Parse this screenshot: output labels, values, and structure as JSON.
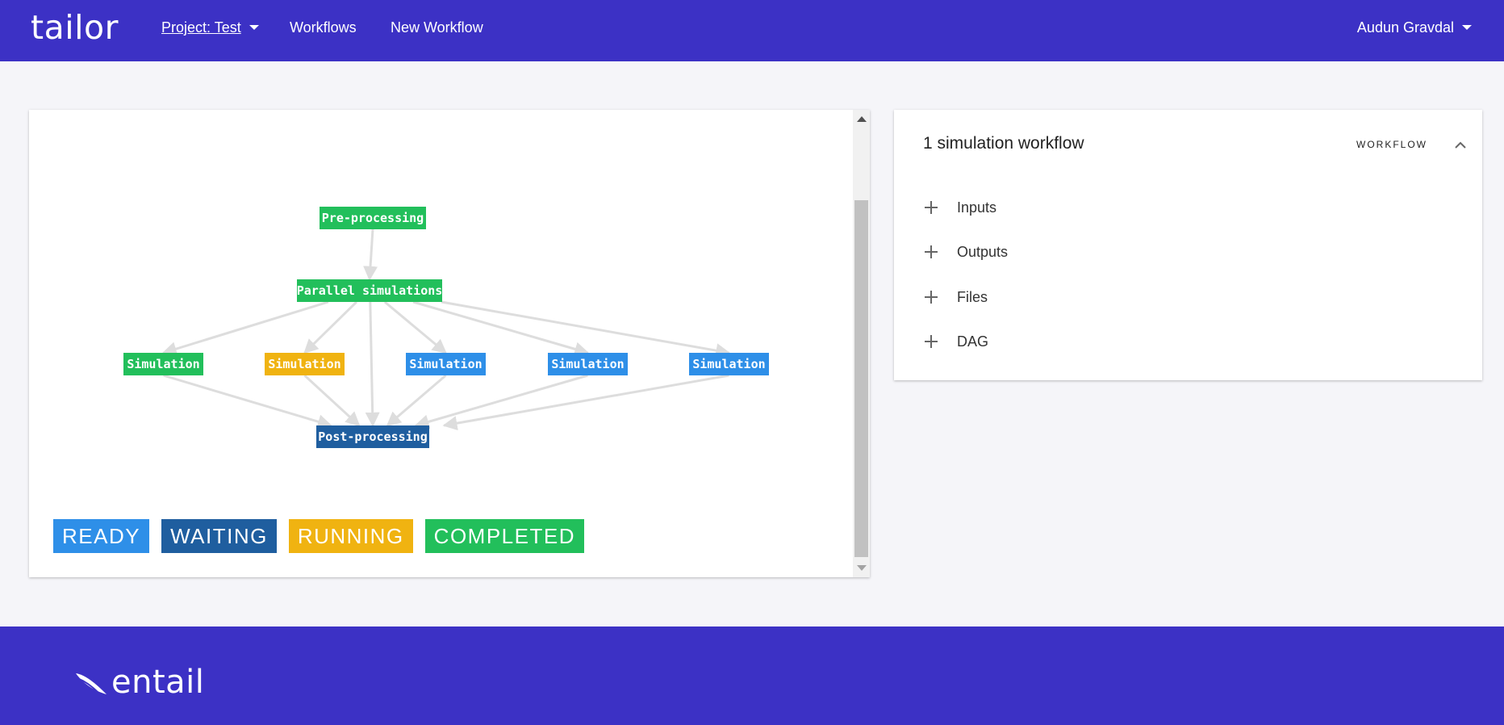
{
  "header": {
    "brand": "tailor",
    "project_label": "Project: Test",
    "workflows_label": "Workflows",
    "new_workflow_label": "New Workflow",
    "user_name": "Audun Gravdal"
  },
  "dag": {
    "colors": {
      "ready": "#2e8fe8",
      "waiting": "#1f5e9f",
      "running": "#f0b311",
      "completed": "#22bf5b",
      "edge": "#dddddd"
    },
    "nodes": [
      {
        "id": "pre",
        "label": "Pre-processing",
        "status": "completed"
      },
      {
        "id": "par",
        "label": "Parallel simulations",
        "status": "completed"
      },
      {
        "id": "sim1",
        "label": "Simulation",
        "status": "completed"
      },
      {
        "id": "sim2",
        "label": "Simulation",
        "status": "running"
      },
      {
        "id": "sim3",
        "label": "Simulation",
        "status": "ready"
      },
      {
        "id": "sim4",
        "label": "Simulation",
        "status": "ready"
      },
      {
        "id": "sim5",
        "label": "Simulation",
        "status": "ready"
      },
      {
        "id": "post",
        "label": "Post-processing",
        "status": "waiting"
      }
    ],
    "legend": [
      {
        "label": "READY",
        "status": "ready"
      },
      {
        "label": "WAITING",
        "status": "waiting"
      },
      {
        "label": "RUNNING",
        "status": "running"
      },
      {
        "label": "COMPLETED",
        "status": "completed"
      }
    ]
  },
  "workflow_panel": {
    "title": "1 simulation workflow",
    "tag": "WORKFLOW",
    "sections": [
      "Inputs",
      "Outputs",
      "Files",
      "DAG"
    ]
  },
  "footer": {
    "logo_text": "entail"
  }
}
